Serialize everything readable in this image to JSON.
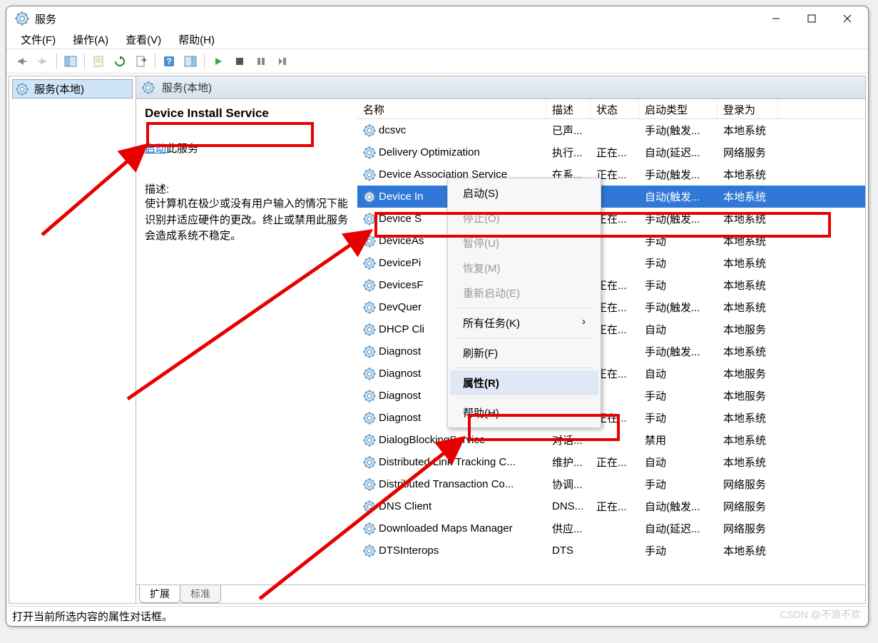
{
  "window": {
    "title": "服务"
  },
  "menubar": [
    "文件(F)",
    "操作(A)",
    "查看(V)",
    "帮助(H)"
  ],
  "tree": {
    "root": "服务(本地)"
  },
  "mainHeader": "服务(本地)",
  "detail": {
    "title": "Device Install Service",
    "actionLink": "启动",
    "actionSuffix": "此服务",
    "descLabel": "描述:",
    "descText": "使计算机在极少或没有用户输入的情况下能识别并适应硬件的更改。终止或禁用此服务会造成系统不稳定。"
  },
  "columns": {
    "name": "名称",
    "desc": "描述",
    "state": "状态",
    "start": "启动类型",
    "logon": "登录为"
  },
  "rows": [
    {
      "name": "dcsvc",
      "desc": "已声...",
      "state": "",
      "start": "手动(触发...",
      "logon": "本地系统",
      "sel": false
    },
    {
      "name": "Delivery Optimization",
      "desc": "执行...",
      "state": "正在...",
      "start": "自动(延迟...",
      "logon": "网络服务",
      "sel": false
    },
    {
      "name": "Device Association Service",
      "desc": "在系...",
      "state": "正在...",
      "start": "手动(触发...",
      "logon": "本地系统",
      "sel": false
    },
    {
      "name": "Device In",
      "desc": "",
      "state": "",
      "start": "自动(触发...",
      "logon": "本地系统",
      "sel": true
    },
    {
      "name": "Device S",
      "desc": "",
      "state": "正在...",
      "start": "手动(触发...",
      "logon": "本地系统",
      "sel": false
    },
    {
      "name": "DeviceAs",
      "desc": "",
      "state": "",
      "start": "手动",
      "logon": "本地系统",
      "sel": false
    },
    {
      "name": "DevicePi",
      "desc": "",
      "state": "",
      "start": "手动",
      "logon": "本地系统",
      "sel": false
    },
    {
      "name": "DevicesF",
      "desc": "",
      "state": "正在...",
      "start": "手动",
      "logon": "本地系统",
      "sel": false
    },
    {
      "name": "DevQuer",
      "desc": "",
      "state": "正在...",
      "start": "手动(触发...",
      "logon": "本地系统",
      "sel": false
    },
    {
      "name": "DHCP Cli",
      "desc": "",
      "state": "正在...",
      "start": "自动",
      "logon": "本地服务",
      "sel": false
    },
    {
      "name": "Diagnost",
      "desc": "",
      "state": "",
      "start": "手动(触发...",
      "logon": "本地系统",
      "sel": false
    },
    {
      "name": "Diagnost",
      "desc": "",
      "state": "正在...",
      "start": "自动",
      "logon": "本地服务",
      "sel": false
    },
    {
      "name": "Diagnost",
      "desc": "",
      "state": "",
      "start": "手动",
      "logon": "本地服务",
      "sel": false
    },
    {
      "name": "Diagnost",
      "desc": "",
      "state": "正在...",
      "start": "手动",
      "logon": "本地系统",
      "sel": false
    },
    {
      "name": "DialogBlockingService",
      "desc": "对话...",
      "state": "",
      "start": "禁用",
      "logon": "本地系统",
      "sel": false
    },
    {
      "name": "Distributed Link Tracking C...",
      "desc": "维护...",
      "state": "正在...",
      "start": "自动",
      "logon": "本地系统",
      "sel": false
    },
    {
      "name": "Distributed Transaction Co...",
      "desc": "协调...",
      "state": "",
      "start": "手动",
      "logon": "网络服务",
      "sel": false
    },
    {
      "name": "DNS Client",
      "desc": "DNS...",
      "state": "正在...",
      "start": "自动(触发...",
      "logon": "网络服务",
      "sel": false
    },
    {
      "name": "Downloaded Maps Manager",
      "desc": "供应...",
      "state": "",
      "start": "自动(延迟...",
      "logon": "网络服务",
      "sel": false
    },
    {
      "name": "DTSInterops",
      "desc": "DTS",
      "state": "",
      "start": "手动",
      "logon": "本地系统",
      "sel": false
    }
  ],
  "contextMenu": {
    "start": "启动(S)",
    "stop": "停止(O)",
    "pause": "暂停(U)",
    "resume": "恢复(M)",
    "restart": "重新启动(E)",
    "allTasks": "所有任务(K)",
    "refresh": "刷新(F)",
    "properties": "属性(R)",
    "help": "帮助(H)"
  },
  "tabs": {
    "extended": "扩展",
    "standard": "标准"
  },
  "statusbar": "打开当前所选内容的属性对话框。",
  "watermark": "CSDN @不浪不欢"
}
